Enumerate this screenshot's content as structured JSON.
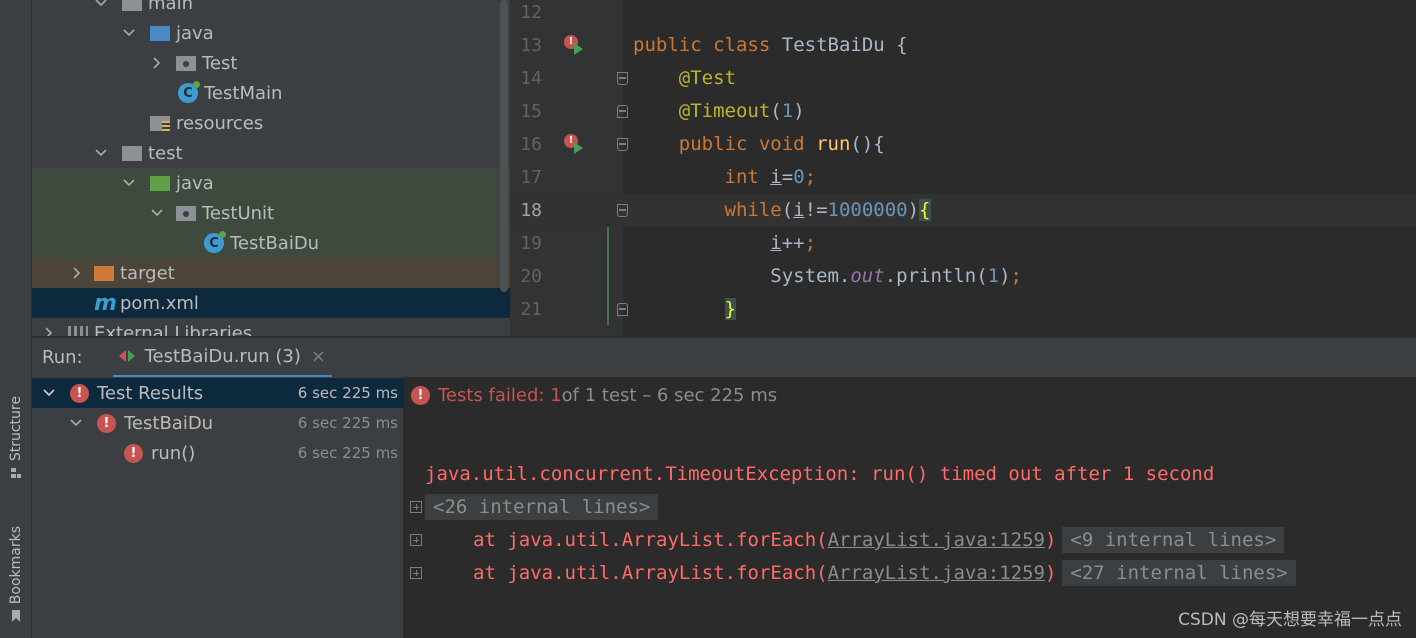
{
  "left_strip": {
    "structure_label": "Structure",
    "bookmarks_label": "Bookmarks"
  },
  "project_tree": {
    "items": [
      {
        "label": "main",
        "kind": "folder-gray",
        "expanded": true
      },
      {
        "label": "java",
        "kind": "folder-blue",
        "expanded": true
      },
      {
        "label": "Test",
        "kind": "package",
        "expanded": false
      },
      {
        "label": "TestMain",
        "kind": "class"
      },
      {
        "label": "resources",
        "kind": "resources"
      },
      {
        "label": "test",
        "kind": "folder-gray",
        "expanded": true
      },
      {
        "label": "java",
        "kind": "folder-green",
        "expanded": true
      },
      {
        "label": "TestUnit",
        "kind": "package",
        "expanded": true
      },
      {
        "label": "TestBaiDu",
        "kind": "class"
      },
      {
        "label": "target",
        "kind": "folder-orange",
        "expanded": false
      },
      {
        "label": "pom.xml",
        "kind": "maven"
      },
      {
        "label": "External Libraries",
        "kind": "libraries",
        "expanded": false
      }
    ]
  },
  "editor": {
    "current_line": "18",
    "lines": [
      {
        "number": "12"
      },
      {
        "number": "13"
      },
      {
        "number": "14"
      },
      {
        "number": "15"
      },
      {
        "number": "16"
      },
      {
        "number": "17"
      },
      {
        "number": "18"
      },
      {
        "number": "19"
      },
      {
        "number": "20"
      },
      {
        "number": "21"
      }
    ],
    "tokens": {
      "l13_public": "public",
      "l13_class": "class",
      "l13_name": "TestBaiDu",
      "l13_brace": "{",
      "l14_ann": "@Test",
      "l15_ann": "@Timeout",
      "l15_open": "(",
      "l15_num": "1",
      "l15_close": ")",
      "l16_public": "public",
      "l16_void": "void",
      "l16_fn": "run",
      "l16_rest": "(){",
      "l17_int": "int",
      "l17_var": "i",
      "l17_eq": "=",
      "l17_num": "0",
      "l17_semi": ";",
      "l18_while": "while",
      "l18_open": "(",
      "l18_var": "i",
      "l18_op": "!=",
      "l18_num": "1000000",
      "l18_close": ")",
      "l18_brace": "{",
      "l19_var": "i",
      "l19_inc": "++",
      "l19_semi": ";",
      "l20_sys": "System.",
      "l20_out": "out",
      "l20_call": ".println(",
      "l20_num": "1",
      "l20_close": ")",
      "l20_semi": ";",
      "l21_brace": "}"
    },
    "error_icon": "!"
  },
  "run_panel": {
    "label": "Run:",
    "tab_label": "TestBaiDu.run (3)",
    "close_glyph": "×",
    "results": [
      {
        "label": "Test Results",
        "time": "6 sec 225 ms",
        "selected": true
      },
      {
        "label": "TestBaiDu",
        "time": "6 sec 225 ms"
      },
      {
        "label": "run()",
        "time": "6 sec 225 ms"
      }
    ],
    "error_icon": "!",
    "status": {
      "failed": "Tests failed: 1",
      "rest": " of 1 test – 6 sec 225 ms"
    },
    "console": {
      "exception": "java.util.concurrent.TimeoutException: run() timed out after 1 second",
      "internal_1": "<26 internal lines>",
      "frame_prefix": "at java.util.ArrayList.forEach(",
      "frame_link": "ArrayList.java:1259",
      "frame_suffix": ")",
      "internal_2": "<9 internal lines>",
      "internal_3": "<27 internal lines>"
    },
    "watermark": "CSDN @每天想要幸福一点点"
  },
  "colors": {
    "accent": "#4a88c7",
    "error": "#c75450",
    "keyword": "#cc7832",
    "annotation": "#bbb529",
    "number": "#6897bb"
  }
}
